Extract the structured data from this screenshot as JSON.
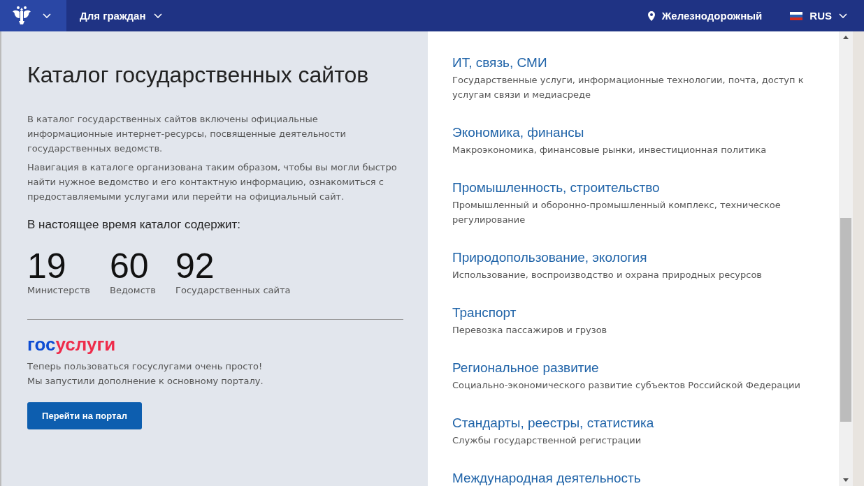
{
  "header": {
    "nav_label": "Для граждан",
    "location": "Железнодорожный",
    "language": "RUS"
  },
  "intro": {
    "title": "Каталог государственных сайтов",
    "paragraphs": [
      "В каталог государственных сайтов включены официальные информационные интернет-ресурсы, посвященные деятельности государственных ведомств.",
      "Навигация в каталоге организована таким образом, чтобы вы могли быстро найти нужное ведомство и его контактную информацию, ознакомиться с предоставляемыми услугами или перейти на официальный сайт."
    ],
    "stats_heading": "В настоящее время каталог содержит:",
    "stats": [
      {
        "value": "19",
        "label": "Министерств"
      },
      {
        "value": "60",
        "label": "Ведомств"
      },
      {
        "value": "92",
        "label": "Государственных сайта"
      }
    ]
  },
  "promo": {
    "logo_first": "гос",
    "logo_second": "услуги",
    "lines": [
      "Теперь пользоваться госуслугами очень просто!",
      "Мы запустили дополнение к основному порталу."
    ],
    "button": "Перейти на портал"
  },
  "categories": [
    {
      "title": "ИТ, связь, СМИ",
      "description": "Государственные услуги, информационные технологии, почта, доступ к услугам связи и медиасреде"
    },
    {
      "title": "Экономика, финансы",
      "description": "Макроэкономика, финансовые рынки, инвестиционная политика"
    },
    {
      "title": "Промышленность, строительство",
      "description": "Промышленный и оборонно-промышленный комплекс, техническое регулирование"
    },
    {
      "title": "Природопользование, экология",
      "description": "Использование, воспроизводство и охрана природных ресурсов"
    },
    {
      "title": "Транспорт",
      "description": "Перевозка пассажиров и грузов"
    },
    {
      "title": "Региональное развитие",
      "description": "Социально-экономического развитие субъектов Российской Федерации"
    },
    {
      "title": "Стандарты, реестры, статистика",
      "description": "Службы государственной регистрации"
    },
    {
      "title": "Международная деятельность"
    }
  ]
}
